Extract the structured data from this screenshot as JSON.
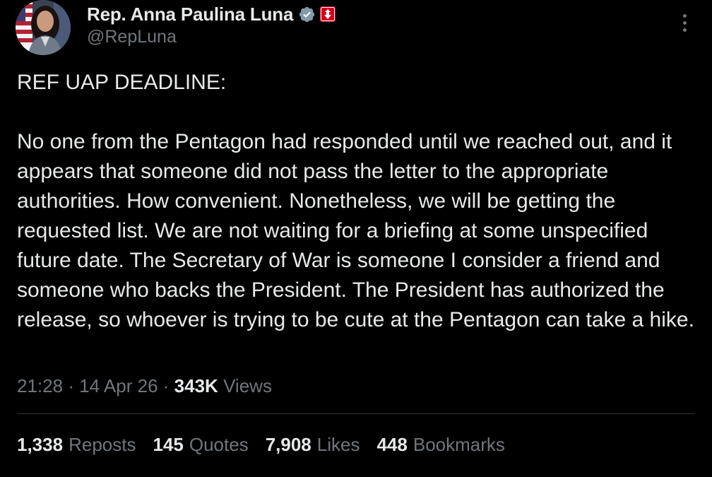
{
  "author": {
    "display_name": "Rep. Anna Paulina Luna",
    "handle": "@RepLuna",
    "avatar": "profile-photo"
  },
  "icons": {
    "verified": "verified-badge-icon",
    "affiliation": "government-affiliation-badge-icon",
    "more": "more-options-icon"
  },
  "colors": {
    "background": "#000000",
    "text_primary": "#e7e9ea",
    "text_secondary": "#71767b",
    "verified_badge": "#829aab",
    "affiliation_badge": "#d0021b",
    "divider": "#2f3336"
  },
  "post": {
    "text": "REF UAP DEADLINE:\n\nNo one from the Pentagon had responded until we reached out, and it appears that someone did not pass the letter to the appropriate authorities. How convenient. Nonetheless, we will be getting the requested list. We are not waiting for a briefing at some unspecified future date. The Secretary of War is someone I consider a friend and someone who backs the President. The President has authorized the release, so whoever is trying to be cute at the Pentagon can take a hike.",
    "time": "21:28",
    "separator": "·",
    "date": "14 Apr 26",
    "views_count": "343K",
    "views_label": "Views"
  },
  "stats": [
    {
      "count": "1,338",
      "label": "Reposts"
    },
    {
      "count": "145",
      "label": "Quotes"
    },
    {
      "count": "7,908",
      "label": "Likes"
    },
    {
      "count": "448",
      "label": "Bookmarks"
    }
  ]
}
